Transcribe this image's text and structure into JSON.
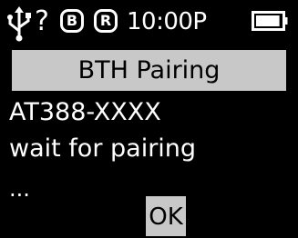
{
  "status_bar": {
    "usb_icon": "usb-icon",
    "unknown_text": "?",
    "badge_b": "B",
    "badge_r": "R",
    "time": "10:00P",
    "battery_icon": "battery-icon",
    "battery_level": 0.95
  },
  "title": "BTH Pairing",
  "body": {
    "device": "AT388-XXXX",
    "message": "wait for pairing",
    "ellipsis": "..."
  },
  "ok_label": "OK",
  "colors": {
    "background": "#000000",
    "text": "#ffffff",
    "highlight": "#c8c8c8"
  }
}
